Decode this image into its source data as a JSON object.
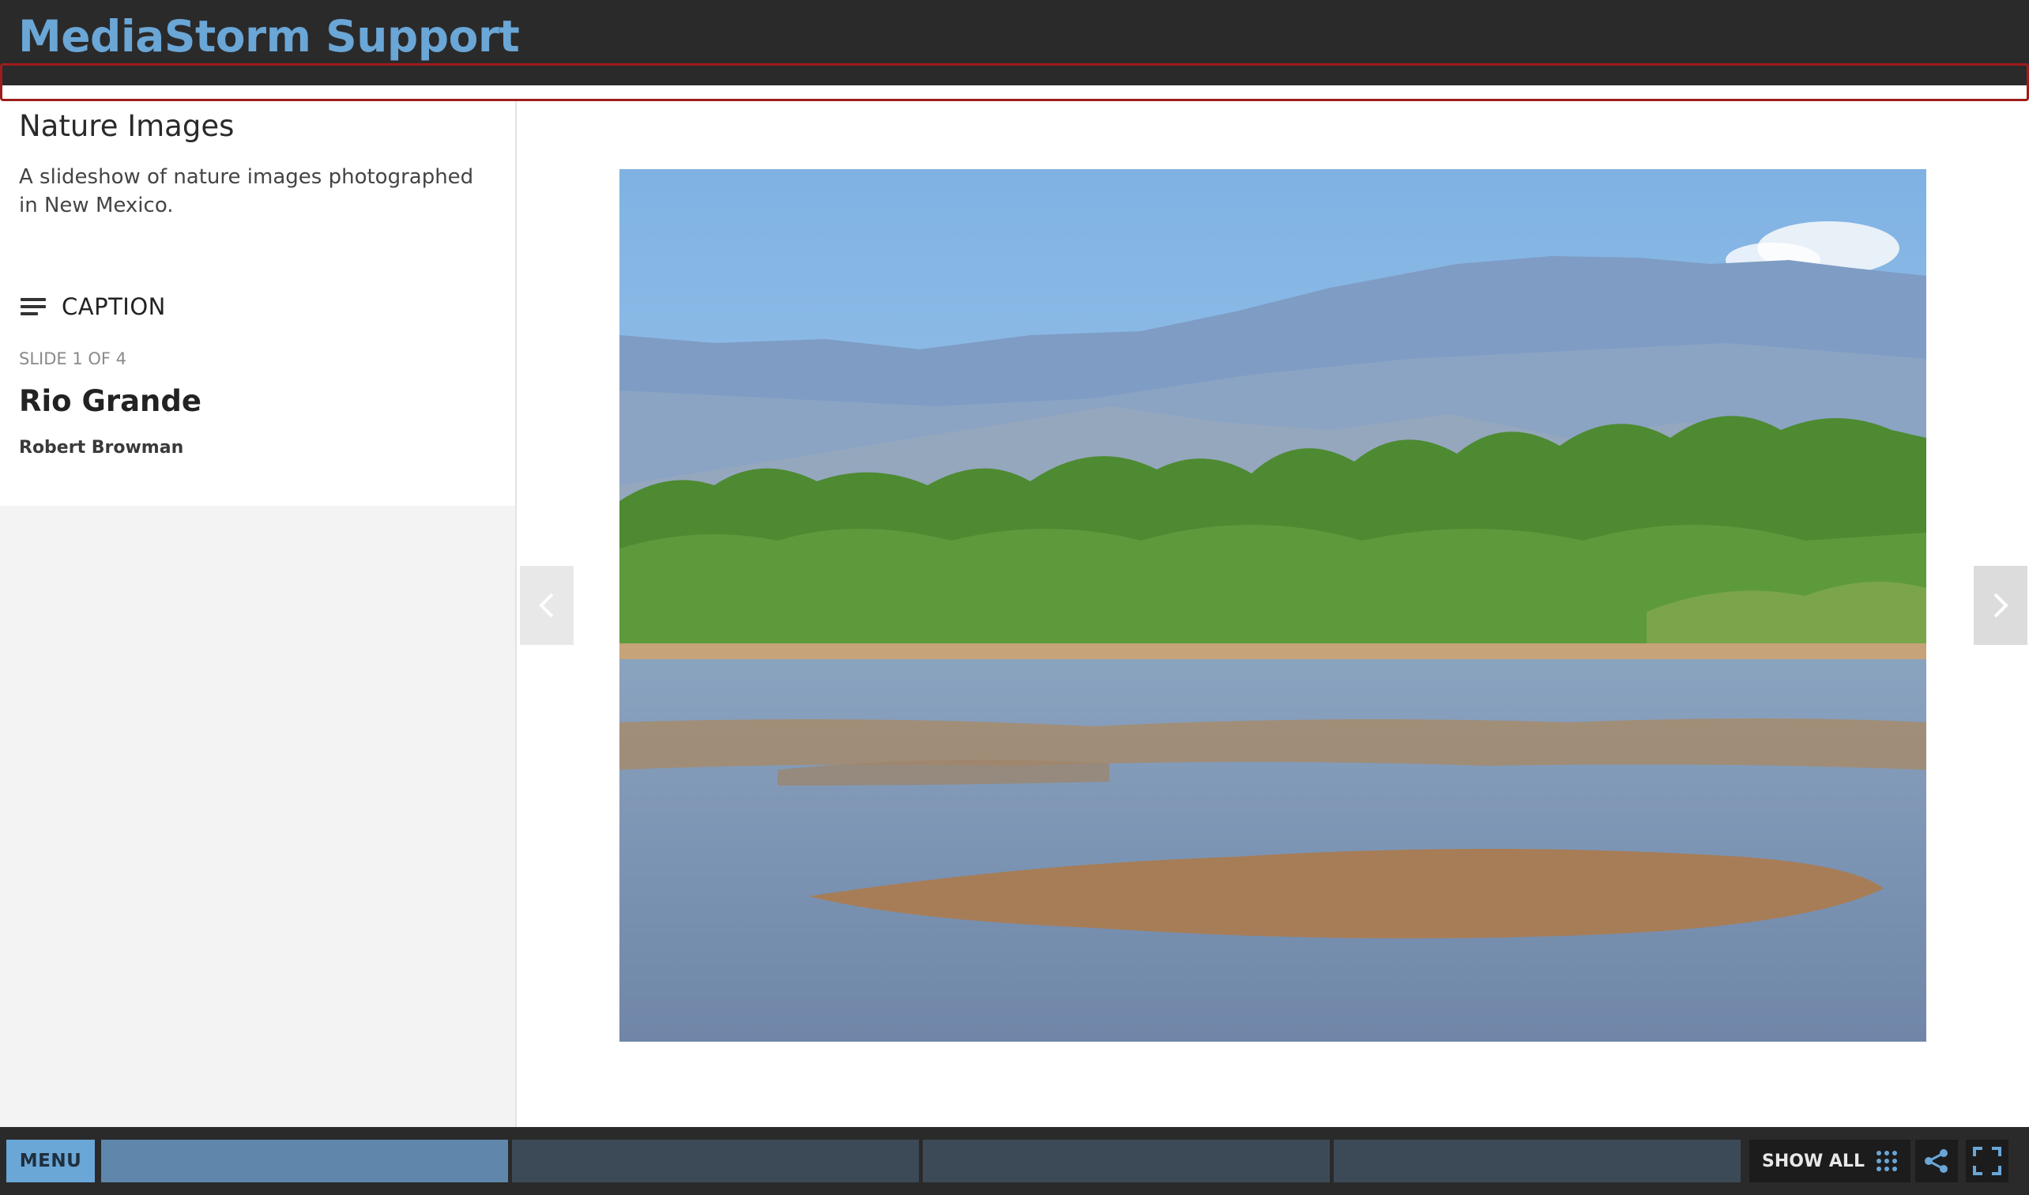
{
  "header": {
    "brand": "MediaStorm Support"
  },
  "sidebar": {
    "project_title": "Nature Images",
    "project_description": "A slideshow of nature images photographed in New Mexico.",
    "caption_label": "CAPTION",
    "slide_count": "SLIDE 1 OF 4",
    "slide_title": "Rio Grande",
    "slide_author": "Robert Browman"
  },
  "bottom_bar": {
    "menu_label": "MENU",
    "show_all_label": "SHOW ALL",
    "slide_tabs_total": 4,
    "active_slide_index": 1
  },
  "icons": {
    "caption": "caption-lines-icon",
    "prev": "chevron-left-icon",
    "next": "chevron-right-icon",
    "grid": "grid-icon",
    "share": "share-icon",
    "fullscreen": "fullscreen-icon"
  },
  "colors": {
    "brand": "#6aa6d6",
    "header_bg": "#2a2a2b",
    "highlight_border": "#a01c1c",
    "active_tab": "#5e87ab",
    "inactive_tab": "#3c4a57"
  }
}
